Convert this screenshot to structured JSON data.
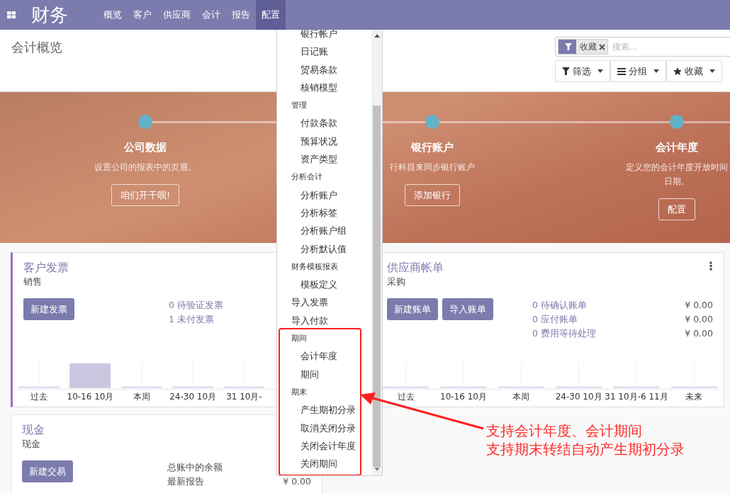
{
  "navbar": {
    "brand": "财务",
    "menus": [
      {
        "label": "概览",
        "selected": false
      },
      {
        "label": "客户",
        "selected": false
      },
      {
        "label": "供应商",
        "selected": false
      },
      {
        "label": "会计",
        "selected": false
      },
      {
        "label": "报告",
        "selected": false
      },
      {
        "label": "配置",
        "selected": true
      }
    ]
  },
  "control_panel": {
    "title": "会计概览",
    "search": {
      "facet": "收藏",
      "placeholder": "搜索..."
    },
    "buttons": [
      {
        "kind": "filter",
        "label": "筛选"
      },
      {
        "kind": "group",
        "label": "分组"
      },
      {
        "kind": "favorite",
        "label": "收藏"
      }
    ]
  },
  "banner": {
    "steps": [
      {
        "title": "公司数据",
        "description": [
          "设置公司的报表中的页眉。"
        ],
        "button": "咱们开干呗!"
      },
      {
        "title": "银行账户",
        "description": [
          "行科目来同步银行账户"
        ],
        "button": "添加银行"
      },
      {
        "title": "会计年度",
        "description": [
          "定义您的会计年度开放时间",
          "日期。"
        ],
        "button": "配置"
      }
    ]
  },
  "cards": [
    {
      "title": "客户发票",
      "subtitle": "销售",
      "color": "#9b6dc6",
      "buttons": [
        "新建发票"
      ],
      "links": [
        "0 待验证发票",
        "1 未付发票"
      ],
      "graph": [
        {
          "label": "过去",
          "filled": false
        },
        {
          "label": "10-16 10月",
          "filled": true
        },
        {
          "label": "本周",
          "filled": false
        },
        {
          "label": "24-30 10月",
          "filled": false
        },
        {
          "label": "31 10月-",
          "filled": false
        }
      ]
    },
    {
      "title": "供应商帐单",
      "subtitle": "采购",
      "menu": true,
      "buttons": [
        "新建账单",
        "导入账单"
      ],
      "rows": [
        {
          "label": "0 待确认账单",
          "amount": "¥ 0.00"
        },
        {
          "label": "0 应付账单",
          "amount": "¥ 0.00"
        },
        {
          "label": "0 费用等待处理",
          "amount": "¥ 0.00"
        }
      ],
      "graph": [
        {
          "label": "过去",
          "filled": false
        },
        {
          "label": "10-16 10月",
          "filled": false
        },
        {
          "label": "本周",
          "filled": false
        },
        {
          "label": "24-30 10月",
          "filled": false
        },
        {
          "label": "31 10月-6 11月",
          "filled": false
        },
        {
          "label": "未来",
          "filled": false
        }
      ]
    },
    {
      "title": "现金",
      "subtitle": "现金",
      "buttons": [
        "新建交易"
      ],
      "plain_rows": [
        {
          "label": "总账中的余额"
        },
        {
          "label": "最新报告",
          "amount": "¥ 0.00"
        }
      ]
    }
  ],
  "dropdown": {
    "entries": [
      {
        "kind": "section",
        "children": [
          "银行帐户",
          "日记账",
          "贸易条款",
          "核销模型"
        ]
      },
      {
        "kind": "section",
        "label": "管理",
        "children": [
          "付款条款",
          "预算状况",
          "资产类型"
        ]
      },
      {
        "kind": "section",
        "label": "分析会计",
        "children": [
          "分析账户",
          "分析标签",
          "分析账户组",
          "分析默认值"
        ]
      },
      {
        "kind": "section",
        "label": "财务模板报表",
        "children": [
          "模板定义"
        ]
      },
      {
        "kind": "item",
        "label": "导入发票"
      },
      {
        "kind": "item",
        "label": "导入付款"
      }
    ],
    "highlighted": [
      {
        "kind": "section",
        "label": "期间",
        "children": [
          "会计年度",
          "期间"
        ]
      },
      {
        "kind": "section",
        "label": "期末",
        "children": [
          "产生期初分录",
          "取消关闭分录",
          "关闭会计年度",
          "关闭期间"
        ]
      }
    ]
  },
  "annotation": {
    "lines": [
      "支持会计年度、会计期间",
      "支持期末转结自动产生期初分录"
    ]
  }
}
